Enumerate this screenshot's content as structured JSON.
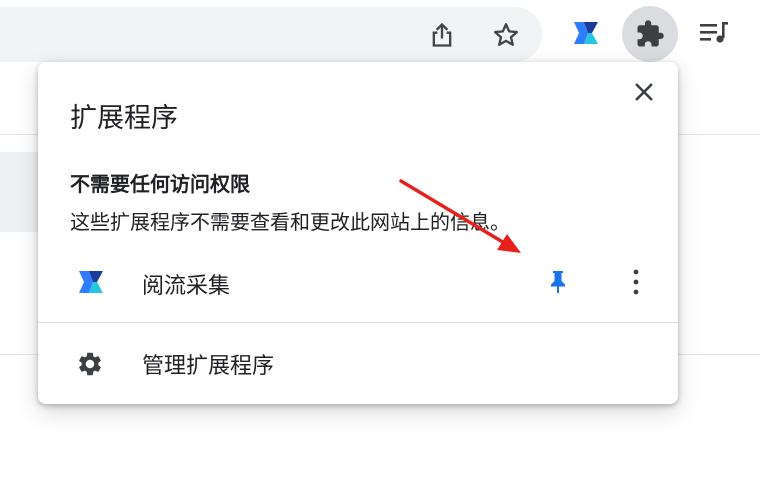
{
  "popup": {
    "title": "扩展程序",
    "section_heading": "不需要任何访问权限",
    "section_description": "这些扩展程序不需要查看和更改此网站上的信息。",
    "extensions": [
      {
        "name": "阅流采集",
        "icon": "yueliu-logo-icon",
        "pinned": true
      }
    ],
    "manage_label": "管理扩展程序"
  },
  "toolbar": {
    "icons": [
      "share-icon",
      "star-icon",
      "yueliu-logo-icon",
      "puzzle-icon",
      "media-queue-icon"
    ]
  },
  "colors": {
    "accent": "#1a73e8",
    "annotation_arrow": "#e8201c"
  }
}
